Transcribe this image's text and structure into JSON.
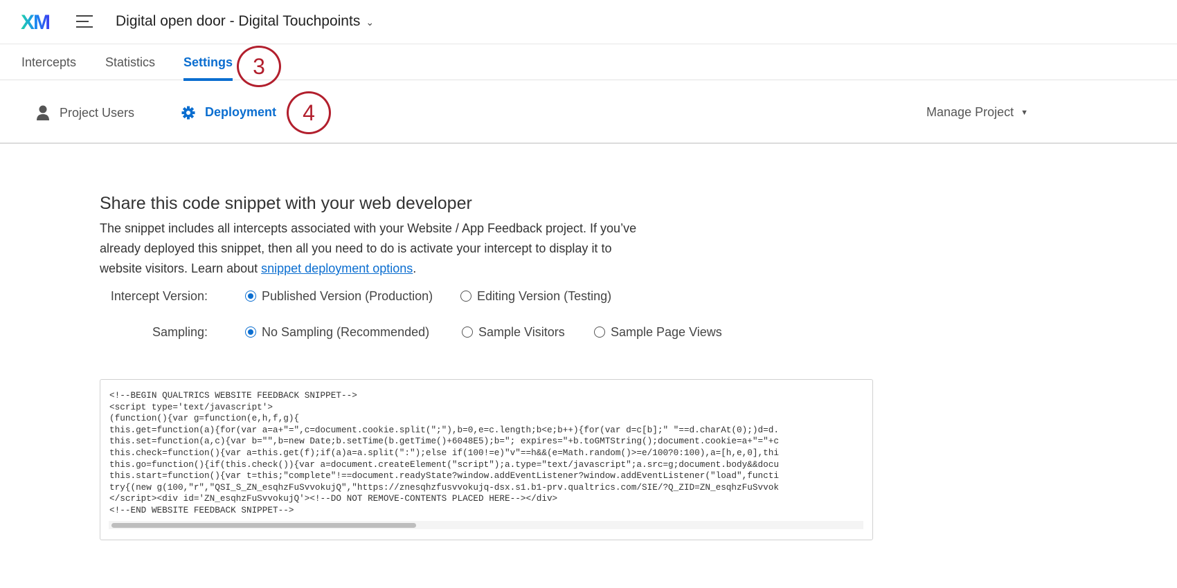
{
  "header": {
    "logo": "XM",
    "project_title": "Digital open door - Digital Touchpoints",
    "title_chevron": "⌄"
  },
  "tabs": [
    {
      "label": "Intercepts"
    },
    {
      "label": "Statistics"
    },
    {
      "label": "Settings",
      "active": true
    }
  ],
  "annotations": [
    "3",
    "4"
  ],
  "subnav": {
    "items": [
      {
        "label": "Project Users",
        "icon": "user-icon"
      },
      {
        "label": "Deployment",
        "icon": "gear-icon",
        "active": true
      }
    ],
    "manage": "Manage Project"
  },
  "content": {
    "heading": "Share this code snippet with your web developer",
    "para_text": "The snippet includes all intercepts associated with your Website / App Feedback project. If you’ve already deployed this snippet, then all you need to do is activate your intercept to display it to website visitors. Learn about ",
    "para_link": "snippet deployment options",
    "para_end": ".",
    "version": {
      "label": "Intercept Version:",
      "options": [
        {
          "label": "Published Version (Production)",
          "selected": true
        },
        {
          "label": "Editing Version (Testing)",
          "selected": false
        }
      ]
    },
    "sampling": {
      "label": "Sampling:",
      "options": [
        {
          "label": "No Sampling (Recommended)",
          "selected": true
        },
        {
          "label": "Sample Visitors",
          "selected": false
        },
        {
          "label": "Sample Page Views",
          "selected": false
        }
      ]
    },
    "code": "<!--BEGIN QUALTRICS WEBSITE FEEDBACK SNIPPET-->\n<script type='text/javascript'>\n(function(){var g=function(e,h,f,g){\nthis.get=function(a){for(var a=a+\"=\",c=document.cookie.split(\";\"),b=0,e=c.length;b<e;b++){for(var d=c[b];\" \"==d.charAt(0);)d=d.\nthis.set=function(a,c){var b=\"\",b=new Date;b.setTime(b.getTime()+6048E5);b=\"; expires=\"+b.toGMTString();document.cookie=a+\"=\"+c\nthis.check=function(){var a=this.get(f);if(a)a=a.split(\":\");else if(100!=e)\"v\"==h&&(e=Math.random()>=e/100?0:100),a=[h,e,0],thi\nthis.go=function(){if(this.check()){var a=document.createElement(\"script\");a.type=\"text/javascript\";a.src=g;document.body&&docu\nthis.start=function(){var t=this;\"complete\"!==document.readyState?window.addEventListener?window.addEventListener(\"load\",functi\ntry{(new g(100,\"r\",\"QSI_S_ZN_esqhzFuSvvokujQ\",\"https://znesqhzfusvvokujq-dsx.s1.b1-prv.qualtrics.com/SIE/?Q_ZID=ZN_esqhzFuSvvok\n</script><div id='ZN_esqhzFuSvvokujQ'><!--DO NOT REMOVE-CONTENTS PLACED HERE--></div>\n<!--END WEBSITE FEEDBACK SNIPPET-->"
  }
}
